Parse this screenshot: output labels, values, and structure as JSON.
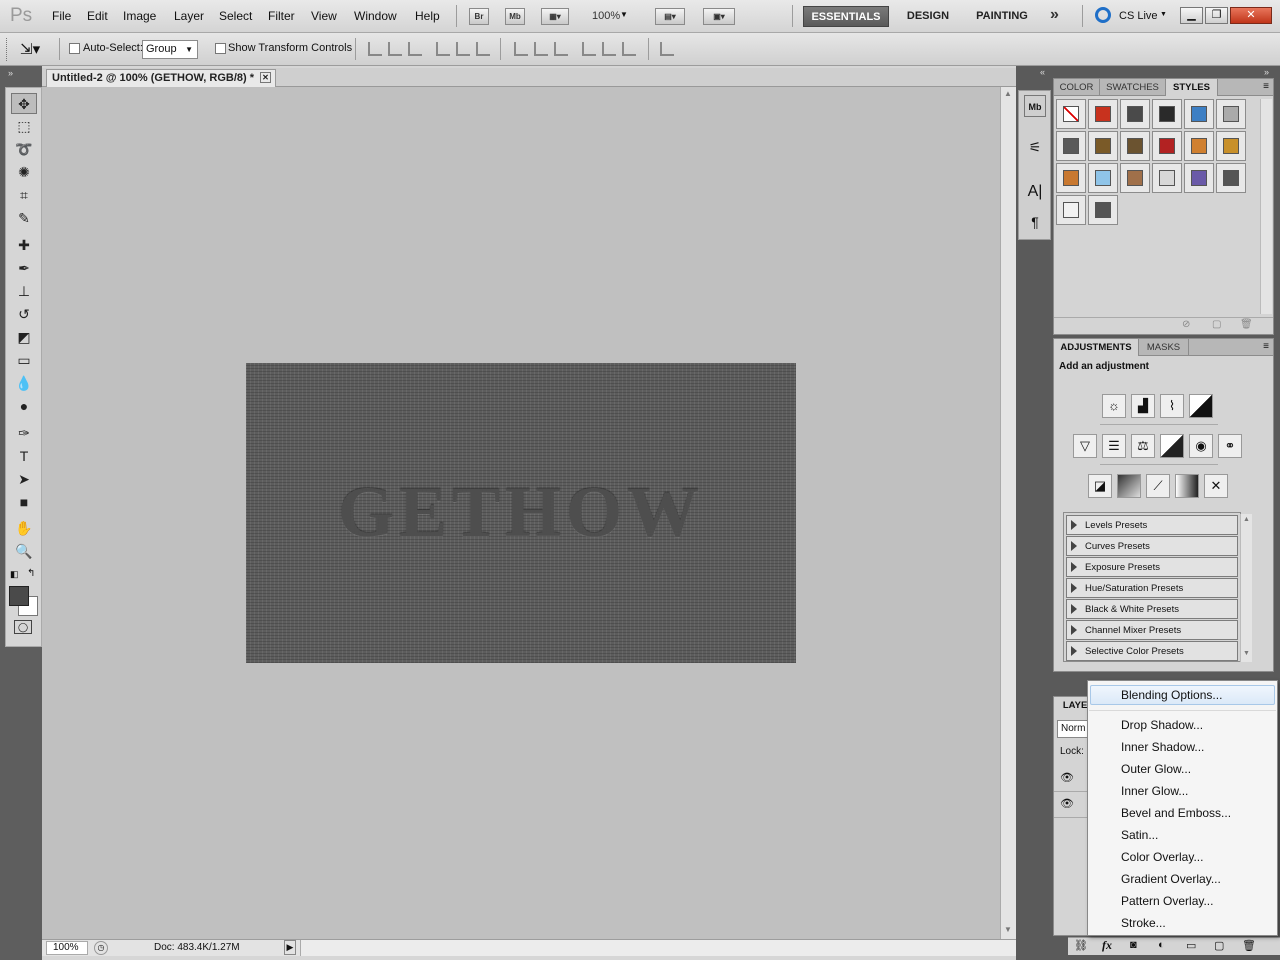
{
  "app": {
    "logo": "Ps"
  },
  "menubar": {
    "items": [
      "File",
      "Edit",
      "Image",
      "Layer",
      "Select",
      "Filter",
      "View",
      "Window",
      "Help"
    ],
    "bridge_label": "Br",
    "minibridge_label": "Mb",
    "zoom": "100%",
    "workspaces": [
      "ESSENTIALS",
      "DESIGN",
      "PAINTING"
    ],
    "more": "»",
    "cs_live": "CS Live"
  },
  "options": {
    "auto_select_label": "Auto-Select:",
    "auto_select_value": "Group",
    "transform_label": "Show Transform Controls"
  },
  "document": {
    "tab_title": "Untitled-2 @ 100% (GETHOW, RGB/8) *",
    "canvas_text": "GETHOW"
  },
  "status": {
    "zoom": "100%",
    "doc": "Doc: 483.4K/1.27M"
  },
  "styles_panel": {
    "tabs": [
      "COLOR",
      "SWATCHES",
      "STYLES"
    ],
    "swatches": [
      "#ffffff",
      "#c8321e",
      "#4a4a4a",
      "#2a2a2a",
      "#3d7fc4",
      "#aaaaaa",
      "#5a5a5a",
      "#7a5a28",
      "#6b5330",
      "#b22222",
      "#d08030",
      "#c8902a",
      "#c87830",
      "#8fc4e8",
      "#a0704a",
      "#d8d8d8",
      "#6a5aa8",
      "#555555",
      "#f2f2f2",
      "#555555"
    ]
  },
  "adjustments_panel": {
    "tabs": [
      "ADJUSTMENTS",
      "MASKS"
    ],
    "heading": "Add an adjustment",
    "presets": [
      "Levels Presets",
      "Curves Presets",
      "Exposure Presets",
      "Hue/Saturation Presets",
      "Black & White Presets",
      "Channel Mixer Presets",
      "Selective Color Presets"
    ]
  },
  "layers_panel": {
    "tab": "LAYER",
    "blend_mode": "Norm",
    "lock_label": "Lock:"
  },
  "fx_menu": {
    "items": [
      "Blending Options...",
      "Drop Shadow...",
      "Inner Shadow...",
      "Outer Glow...",
      "Inner Glow...",
      "Bevel and Emboss...",
      "Satin...",
      "Color Overlay...",
      "Gradient Overlay...",
      "Pattern Overlay...",
      "Stroke..."
    ]
  }
}
